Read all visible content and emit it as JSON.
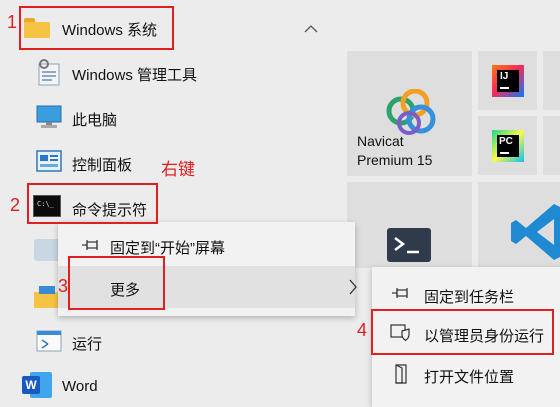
{
  "start_menu": {
    "group_title": "Windows 系统",
    "items": [
      {
        "label": "Windows 管理工具",
        "icon": "admin-tools-icon"
      },
      {
        "label": "此电脑",
        "icon": "computer-icon"
      },
      {
        "label": "控制面板",
        "icon": "control-panel-icon"
      },
      {
        "label": "命令提示符",
        "icon": "cmd-icon"
      },
      {
        "label": "运行",
        "icon": "run-icon"
      },
      {
        "label": "Word",
        "icon": "word-icon"
      }
    ]
  },
  "tiles": {
    "navicat_line1": "Navicat",
    "navicat_line2": "Premium 15",
    "intellij_badge": "IJ",
    "pycharm_badge": "PC"
  },
  "context_menu": {
    "pin_start": "固定到“开始”屏幕",
    "more": "更多"
  },
  "submenu": {
    "pin_taskbar": "固定到任务栏",
    "run_as_admin": "以管理员身份运行",
    "open_location": "打开文件位置"
  },
  "annotations": {
    "step1": "1",
    "step2": "2",
    "step3": "3",
    "step4": "4",
    "right_click_note": "右键"
  },
  "colors": {
    "annotation_red": "#e02020",
    "vscode_blue": "#1f8ad2",
    "folder_yellow": "#f6c344"
  }
}
